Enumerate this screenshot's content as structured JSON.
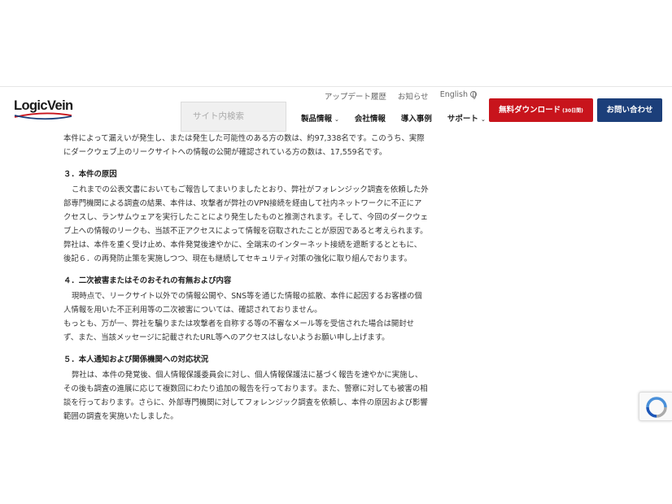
{
  "logo": {
    "text": "LogicVein"
  },
  "util_nav": {
    "update_history": "アップデート履歴",
    "news": "お知らせ",
    "language": "English"
  },
  "search": {
    "placeholder": "サイト内検索"
  },
  "main_nav": [
    {
      "label": "製品情報",
      "has_dropdown": true
    },
    {
      "label": "会社情報",
      "has_dropdown": false
    },
    {
      "label": "導入事例",
      "has_dropdown": false
    },
    {
      "label": "サポート",
      "has_dropdown": true
    }
  ],
  "cta": {
    "download_label": "無料ダウンロード",
    "download_note": "(30日間)",
    "contact_label": "お問い合わせ"
  },
  "colors": {
    "download_bg": "#c8141c",
    "contact_bg": "#1c3f7a"
  },
  "article": {
    "intro": [
      "本件によって漏えいが発生し、または発生した可能性のある方の数は、約97,338名です。このうち、実際",
      "にダークウェブ上のリークサイトへの情報の公開が確認されている方の数は、17,559名です。"
    ],
    "sections": [
      {
        "heading": "３．本件の原因",
        "lines": [
          "これまでの公表文書においてもご報告してまいりましたとおり、弊社がフォレンジック調査を依頼した外",
          "部専門機関による調査の結果、本件は、攻撃者が弊社のVPN接続を経由して社内ネットワークに不正にア",
          "クセスし、ランサムウェアを実行したことにより発生したものと推測されます。そして、今回のダークウェ",
          "ブ上への情報のリークも、当該不正アクセスによって情報を窃取されたことが原因であると考えられます。",
          "弊社は、本件を重く受け止め、本件発覚後速やかに、全端末のインターネット接続を遮断するとともに、",
          "後記６．の再発防止策を実施しつつ、現在も継続してセキュリティ対策の強化に取り組んでおります。"
        ]
      },
      {
        "heading": "４．二次被害またはそのおそれの有無および内容",
        "lines": [
          "現時点で、リークサイト以外での情報公開や、SNS等を通じた情報の拡散、本件に起因するお客様の個",
          "人情報を用いた不正利用等の二次被害については、確認されておりません。",
          "もっとも、万が一、弊社を騙りまたは攻撃者を自称する等の不審なメール等を受信された場合は開封せ",
          "ず、また、当該メッセージに記載されたURL等へのアクセスはしないようお願い申し上げます。"
        ]
      },
      {
        "heading": "５．本人通知および関係機関への対応状況",
        "lines": [
          "弊社は、本件の発覚後、個人情報保護委員会に対し、個人情報保護法に基づく報告を速やかに実施し、",
          "その後も調査の進展に応じて複数回にわたり追加の報告を行っております。また、警察に対しても被害の相",
          "談を行っております。さらに、外部専門機関に対してフォレンジック調査を依頼し、本件の原因および影響",
          "範囲の調査を実施いたしました。"
        ]
      }
    ]
  }
}
